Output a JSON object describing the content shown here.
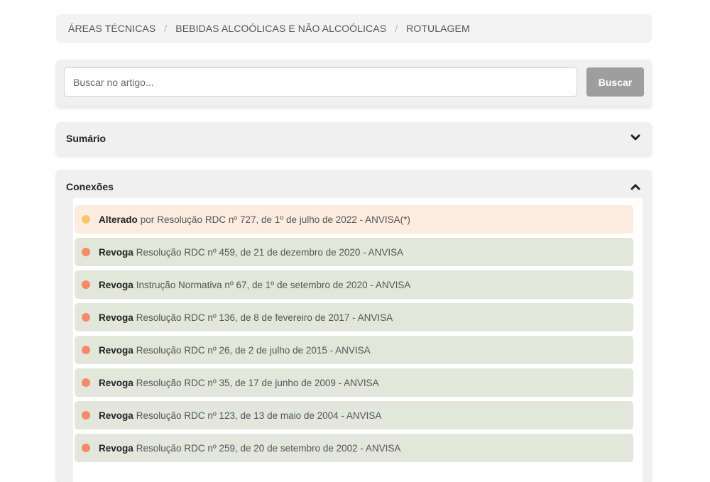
{
  "breadcrumb": {
    "items": [
      "ÁREAS TÉCNICAS",
      "BEBIDAS ALCOÓLICAS E NÃO ALCOÓLICAS",
      "ROTULAGEM"
    ],
    "separator": "/"
  },
  "search": {
    "placeholder": "Buscar no artigo...",
    "value": "",
    "button_label": "Buscar"
  },
  "sumario": {
    "title": "Sumário",
    "expanded": false,
    "icon": "chevron-down-icon"
  },
  "conexoes": {
    "title": "Conexões",
    "expanded": true,
    "icon": "chevron-up-icon",
    "items": [
      {
        "relation": "Alterado",
        "conj": "por",
        "text": "Resolução RDC nº 727, de 1º de julho de 2022 - ANVISA(*)",
        "status": "altered"
      },
      {
        "relation": "Revoga",
        "conj": "",
        "text": "Resolução RDC nº 459, de 21 de dezembro de 2020 - ANVISA",
        "status": "revoked"
      },
      {
        "relation": "Revoga",
        "conj": "",
        "text": "Instrução Normativa nº 67, de 1º de setembro de 2020 - ANVISA",
        "status": "revoked"
      },
      {
        "relation": "Revoga",
        "conj": "",
        "text": "Resolução RDC nº 136, de 8 de fevereiro de 2017 - ANVISA",
        "status": "revoked"
      },
      {
        "relation": "Revoga",
        "conj": "",
        "text": "Resolução RDC nº 26, de 2 de julho de 2015 - ANVISA",
        "status": "revoked"
      },
      {
        "relation": "Revoga",
        "conj": "",
        "text": "Resolução RDC nº 35, de 17 de junho de 2009 - ANVISA",
        "status": "revoked"
      },
      {
        "relation": "Revoga",
        "conj": "",
        "text": "Resolução RDC nº 123, de 13 de maio de 2004 - ANVISA",
        "status": "revoked"
      },
      {
        "relation": "Revoga",
        "conj": "",
        "text": "Resolução RDC nº 259, de 20 de setembro de 2002 - ANVISA",
        "status": "revoked"
      }
    ]
  },
  "colors": {
    "altered_dot": "#f8c56f",
    "altered_bg": "#fcece0",
    "revoked_dot": "#f58a68",
    "revoked_bg": "#e2e6db",
    "button_bg": "#9e9e9e"
  }
}
